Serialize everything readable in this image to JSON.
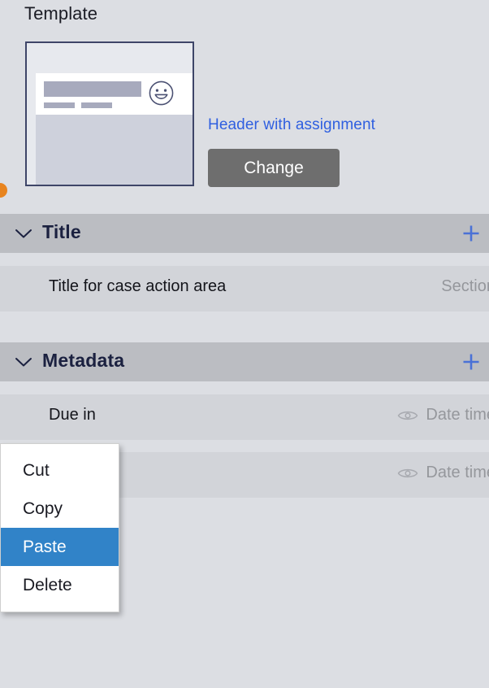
{
  "template": {
    "label": "Template",
    "name": "Header with assignment",
    "change_button": "Change",
    "thumbnail_icon": "smiley-face-avatar-icon"
  },
  "sections": [
    {
      "id": "title",
      "title": "Title",
      "collapse_icon": "chevron-down-icon",
      "add_icon": "plus-icon",
      "rows": [
        {
          "label": "Title for case action area",
          "type": "Section",
          "visibility_icon": null
        }
      ]
    },
    {
      "id": "metadata",
      "title": "Metadata",
      "collapse_icon": "chevron-down-icon",
      "add_icon": "plus-icon",
      "rows": [
        {
          "label": "Due in",
          "type": "Date time",
          "visibility_icon": "eye-icon"
        },
        {
          "label": "",
          "type": "Date time",
          "visibility_icon": "eye-icon"
        }
      ]
    }
  ],
  "context_menu": {
    "items": [
      {
        "label": "Cut",
        "selected": false
      },
      {
        "label": "Copy",
        "selected": false
      },
      {
        "label": "Paste",
        "selected": true
      },
      {
        "label": "Delete",
        "selected": false
      }
    ]
  },
  "colors": {
    "panel_background": "#dcdee3",
    "section_header": "#bbbdc2",
    "row_background": "#d2d4d9",
    "link": "#2f5fe0",
    "accent_plus": "#4a71d6",
    "selection": "#3183c8",
    "button": "#6e6e6e",
    "handle": "#e8841f",
    "muted_text": "#95979c"
  }
}
